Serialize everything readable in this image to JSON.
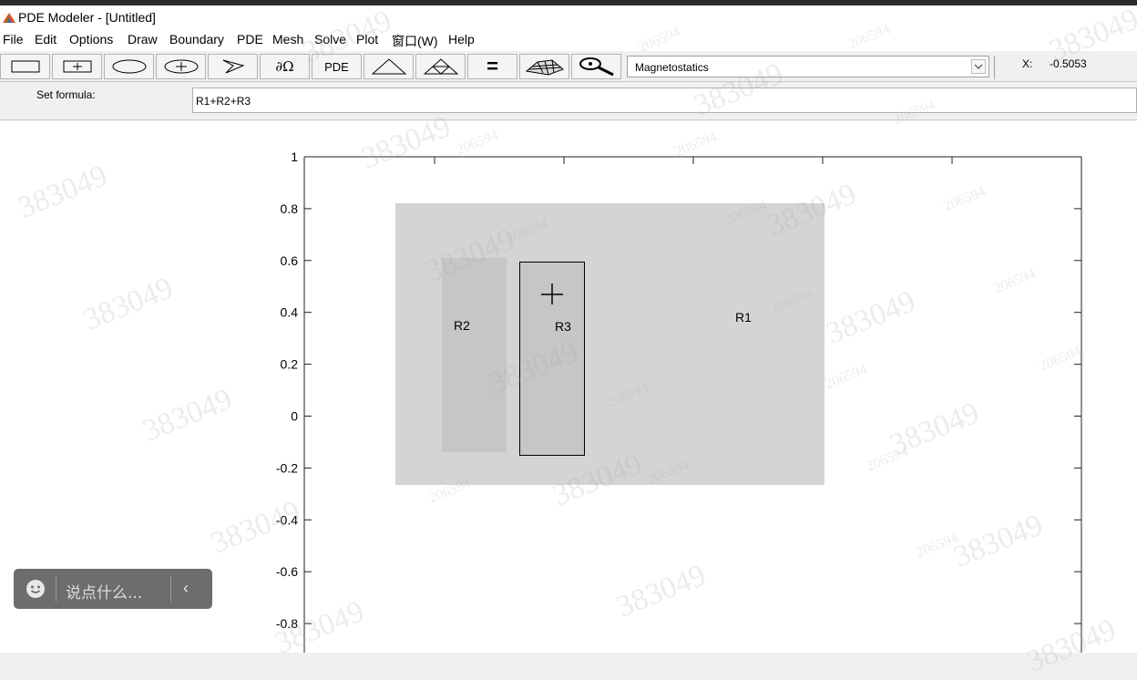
{
  "window": {
    "title": "PDE Modeler - [Untitled]",
    "app_icon": "matlab-icon"
  },
  "menu": [
    "File",
    "Edit",
    "Options",
    "Draw",
    "Boundary",
    "PDE",
    "Mesh",
    "Solve",
    "Plot",
    "窗口(W)",
    "Help"
  ],
  "toolbar": {
    "buttons": [
      {
        "id": "rectangle-icon"
      },
      {
        "id": "rectangle-center-icon"
      },
      {
        "id": "ellipse-icon"
      },
      {
        "id": "ellipse-center-icon"
      },
      {
        "id": "polygon-icon"
      },
      {
        "id": "boundary-mode-icon",
        "label": "∂Ω"
      },
      {
        "id": "pde-spec-icon",
        "label": "PDE"
      },
      {
        "id": "init-mesh-icon"
      },
      {
        "id": "refine-mesh-icon"
      },
      {
        "id": "solve-icon",
        "label": "="
      },
      {
        "id": "plot-solution-icon"
      },
      {
        "id": "zoom-icon"
      }
    ],
    "application_mode": "Magnetostatics",
    "coord_label": "X:",
    "coord_value": "-0.5053"
  },
  "formula": {
    "label": "Set formula:",
    "value": "R1+R2+R3"
  },
  "chart_data": {
    "type": "geometry-plot",
    "title": "",
    "xlabel": "",
    "ylabel": "",
    "y_ticks": [
      "1",
      "0.8",
      "0.6",
      "0.4",
      "0.2",
      "0",
      "-0.2",
      "-0.4",
      "-0.6",
      "-0.8"
    ],
    "y_tick_values": [
      1,
      0.8,
      0.6,
      0.4,
      0.2,
      0,
      -0.2,
      -0.4,
      -0.6,
      -0.8
    ],
    "shapes": [
      {
        "name": "R1",
        "type": "rectangle",
        "y_range": [
          -0.27,
          0.82
        ],
        "selected": false
      },
      {
        "name": "R2",
        "type": "rectangle",
        "y_range": [
          -0.14,
          0.61
        ],
        "selected": false
      },
      {
        "name": "R3",
        "type": "rectangle",
        "y_range": [
          -0.15,
          0.6
        ],
        "selected": true
      }
    ],
    "cursor": "crosshair"
  },
  "watermark_texts": [
    "383049",
    "206594"
  ],
  "chat_widget": {
    "placeholder": "说点什么...",
    "icon": "smiley-icon",
    "collapse_icon": "chevron-left-icon"
  }
}
